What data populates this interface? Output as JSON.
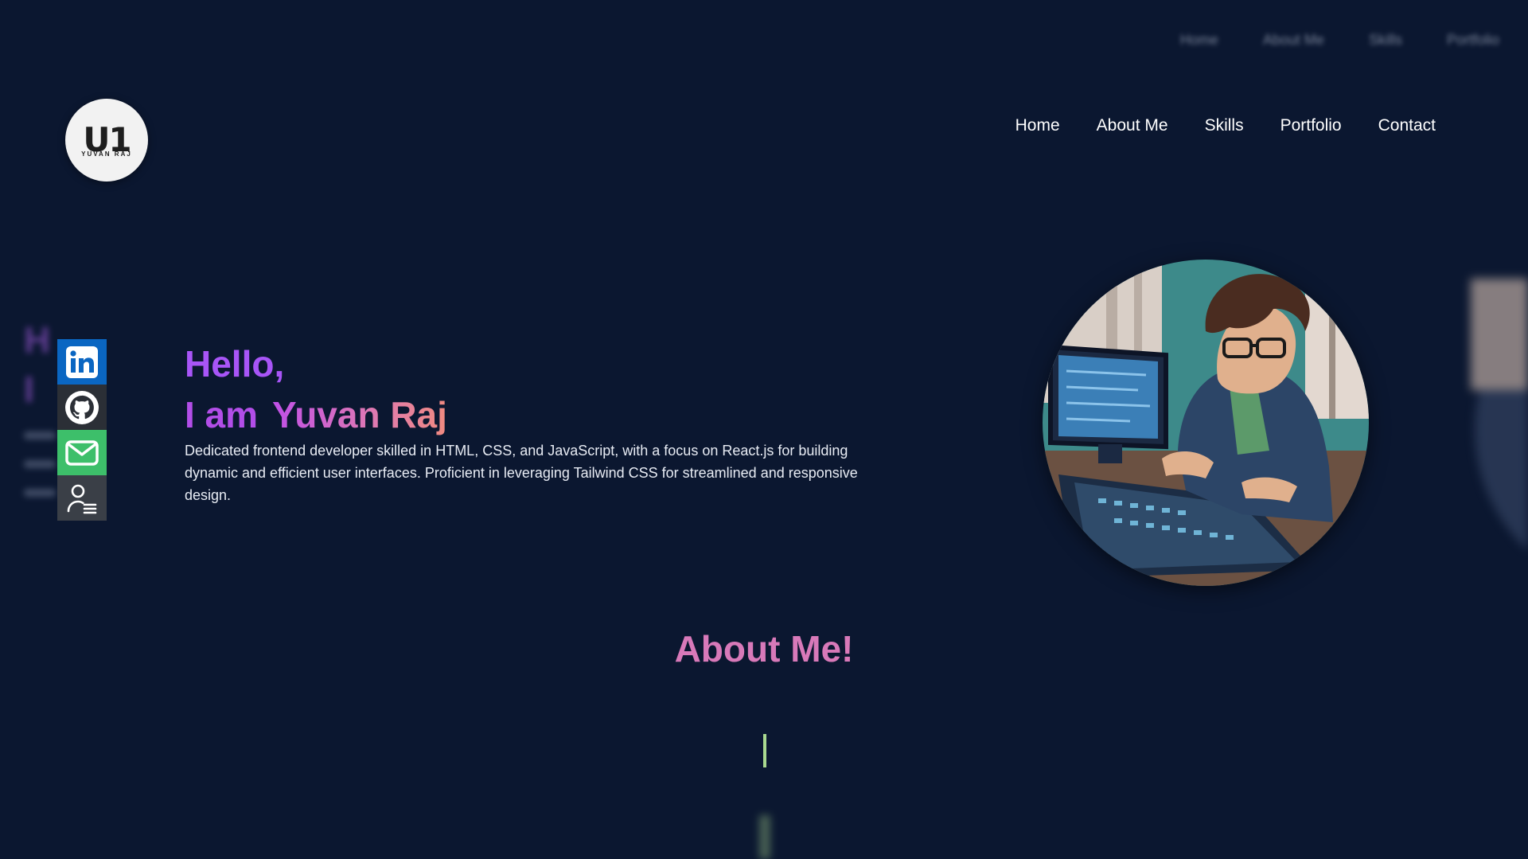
{
  "ghost_nav": [
    "Home",
    "About Me",
    "Skills",
    "Portfolio"
  ],
  "logo": {
    "mark": "U1",
    "subtitle": "YUVAN RAJ"
  },
  "nav": {
    "items": [
      {
        "label": "Home"
      },
      {
        "label": "About Me"
      },
      {
        "label": "Skills"
      },
      {
        "label": "Portfolio"
      },
      {
        "label": "Contact"
      }
    ]
  },
  "social": [
    {
      "name": "linkedin-icon",
      "color": "#0a66c2"
    },
    {
      "name": "github-icon",
      "color": "#2b2f36"
    },
    {
      "name": "mail-icon",
      "color": "#3dbf6a"
    },
    {
      "name": "resume-icon",
      "color": "#3a3f47"
    }
  ],
  "hero": {
    "greeting": "Hello,",
    "intro_prefix": "I am",
    "name": "Yuvan Raj",
    "bio": "Dedicated frontend developer skilled in HTML, CSS, and JavaScript, with a focus on React.js for building dynamic and efficient user interfaces. Proficient in leveraging Tailwind CSS for streamlined and responsive design."
  },
  "about": {
    "title": "About Me!"
  },
  "colors": {
    "background": "#0b1730",
    "accent_purple": "#a855f7",
    "accent_pink": "#d879b9",
    "cursor": "#a9d98f"
  }
}
